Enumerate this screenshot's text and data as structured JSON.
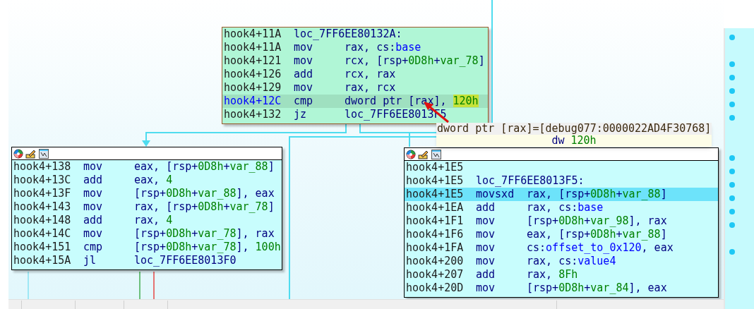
{
  "blocks": [
    {
      "kind": "active",
      "header": false,
      "lines": [
        {
          "addr": "hook4+11A",
          "label": "loc_7FF6EE80132A:",
          "selected": false
        },
        {
          "addr": "hook4+11A",
          "mnem": "mov",
          "ops": [
            {
              "kind": "plain",
              "text": "rax, cs:"
            },
            {
              "kind": "name",
              "text": "base"
            }
          ],
          "selected": false
        },
        {
          "addr": "hook4+121",
          "mnem": "mov",
          "ops": [
            {
              "kind": "plain",
              "text": "rcx, [rsp+"
            },
            {
              "kind": "number",
              "text": "0D8h"
            },
            {
              "kind": "plain",
              "text": "+"
            },
            {
              "kind": "number",
              "text": "var_78"
            },
            {
              "kind": "plain",
              "text": "]"
            }
          ],
          "selected": false
        },
        {
          "addr": "hook4+126",
          "mnem": "add",
          "ops": [
            {
              "kind": "plain",
              "text": "rcx, rax"
            }
          ],
          "selected": false
        },
        {
          "addr": "hook4+129",
          "mnem": "mov",
          "ops": [
            {
              "kind": "plain",
              "text": "rax, rcx"
            }
          ],
          "selected": false
        },
        {
          "addr": "hook4+12C",
          "mnem": "cmp",
          "ops": [
            {
              "kind": "plain",
              "text": "dword ptr [rax], "
            },
            {
              "kind": "number",
              "text": "120h",
              "highlighted": true
            }
          ],
          "selected": true
        },
        {
          "addr": "hook4+132",
          "mnem": "jz",
          "ops": [
            {
              "kind": "plain",
              "text": "loc_7FF6EE8013F5"
            }
          ],
          "selected": false
        }
      ]
    },
    {
      "kind": "normal",
      "header": true,
      "lines": [
        {
          "addr": "hook4+138",
          "mnem": "mov",
          "ops": [
            {
              "kind": "plain",
              "text": "eax, [rsp+"
            },
            {
              "kind": "number",
              "text": "0D8h"
            },
            {
              "kind": "plain",
              "text": "+"
            },
            {
              "kind": "number",
              "text": "var_88"
            },
            {
              "kind": "plain",
              "text": "]"
            }
          ],
          "selected": false
        },
        {
          "addr": "hook4+13C",
          "mnem": "add",
          "ops": [
            {
              "kind": "plain",
              "text": "eax, "
            },
            {
              "kind": "number",
              "text": "4"
            }
          ],
          "selected": false
        },
        {
          "addr": "hook4+13F",
          "mnem": "mov",
          "ops": [
            {
              "kind": "plain",
              "text": "[rsp+"
            },
            {
              "kind": "number",
              "text": "0D8h"
            },
            {
              "kind": "plain",
              "text": "+"
            },
            {
              "kind": "number",
              "text": "var_88"
            },
            {
              "kind": "plain",
              "text": "], eax"
            }
          ],
          "selected": false
        },
        {
          "addr": "hook4+143",
          "mnem": "mov",
          "ops": [
            {
              "kind": "plain",
              "text": "rax, [rsp+"
            },
            {
              "kind": "number",
              "text": "0D8h"
            },
            {
              "kind": "plain",
              "text": "+"
            },
            {
              "kind": "number",
              "text": "var_78"
            },
            {
              "kind": "plain",
              "text": "]"
            }
          ],
          "selected": false
        },
        {
          "addr": "hook4+148",
          "mnem": "add",
          "ops": [
            {
              "kind": "plain",
              "text": "rax, "
            },
            {
              "kind": "number",
              "text": "4"
            }
          ],
          "selected": false
        },
        {
          "addr": "hook4+14C",
          "mnem": "mov",
          "ops": [
            {
              "kind": "plain",
              "text": "[rsp+"
            },
            {
              "kind": "number",
              "text": "0D8h"
            },
            {
              "kind": "plain",
              "text": "+"
            },
            {
              "kind": "number",
              "text": "var_78"
            },
            {
              "kind": "plain",
              "text": "], rax"
            }
          ],
          "selected": false
        },
        {
          "addr": "hook4+151",
          "mnem": "cmp",
          "ops": [
            {
              "kind": "plain",
              "text": "[rsp+"
            },
            {
              "kind": "number",
              "text": "0D8h"
            },
            {
              "kind": "plain",
              "text": "+"
            },
            {
              "kind": "number",
              "text": "var_78"
            },
            {
              "kind": "plain",
              "text": "], "
            },
            {
              "kind": "number",
              "text": "100h"
            }
          ],
          "selected": false
        },
        {
          "addr": "hook4+15A",
          "mnem": "jl",
          "ops": [
            {
              "kind": "plain",
              "text": "loc_7FF6EE8013F0"
            }
          ],
          "selected": false
        }
      ]
    },
    {
      "kind": "normal",
      "header": true,
      "lines": [
        {
          "addr": "hook4+1E5",
          "selected": false
        },
        {
          "addr": "hook4+1E5",
          "label": "loc_7FF6EE8013F5:",
          "selected": false
        },
        {
          "addr": "hook4+1E5",
          "mnem": "movsxd",
          "ops": [
            {
              "kind": "plain",
              "text": "rax, [rsp+"
            },
            {
              "kind": "number",
              "text": "0D8h"
            },
            {
              "kind": "plain",
              "text": "+"
            },
            {
              "kind": "number",
              "text": "var_88"
            },
            {
              "kind": "plain",
              "text": "]"
            }
          ],
          "selected": true
        },
        {
          "addr": "hook4+1EA",
          "mnem": "add",
          "ops": [
            {
              "kind": "plain",
              "text": "rax, cs:"
            },
            {
              "kind": "name",
              "text": "base"
            }
          ],
          "selected": false
        },
        {
          "addr": "hook4+1F1",
          "mnem": "mov",
          "ops": [
            {
              "kind": "plain",
              "text": "[rsp+"
            },
            {
              "kind": "number",
              "text": "0D8h"
            },
            {
              "kind": "plain",
              "text": "+"
            },
            {
              "kind": "number",
              "text": "var_98"
            },
            {
              "kind": "plain",
              "text": "], rax"
            }
          ],
          "selected": false
        },
        {
          "addr": "hook4+1F6",
          "mnem": "mov",
          "ops": [
            {
              "kind": "plain",
              "text": "eax, [rsp+"
            },
            {
              "kind": "number",
              "text": "0D8h"
            },
            {
              "kind": "plain",
              "text": "+"
            },
            {
              "kind": "number",
              "text": "var_88"
            },
            {
              "kind": "plain",
              "text": "]"
            }
          ],
          "selected": false
        },
        {
          "addr": "hook4+1FA",
          "mnem": "mov",
          "ops": [
            {
              "kind": "plain",
              "text": "cs:"
            },
            {
              "kind": "name",
              "text": "offset_to_0x120"
            },
            {
              "kind": "plain",
              "text": ", eax"
            }
          ],
          "selected": false
        },
        {
          "addr": "hook4+200",
          "mnem": "mov",
          "ops": [
            {
              "kind": "plain",
              "text": "rax, cs:"
            },
            {
              "kind": "name",
              "text": "value4"
            }
          ],
          "selected": false
        },
        {
          "addr": "hook4+207",
          "mnem": "add",
          "ops": [
            {
              "kind": "plain",
              "text": "rax, "
            },
            {
              "kind": "number",
              "text": "8Fh"
            }
          ],
          "selected": false
        },
        {
          "addr": "hook4+20D",
          "mnem": "mov",
          "ops": [
            {
              "kind": "plain",
              "text": "[rsp+"
            },
            {
              "kind": "number",
              "text": "0D8h"
            },
            {
              "kind": "plain",
              "text": "+"
            },
            {
              "kind": "number",
              "text": "var_84"
            },
            {
              "kind": "plain",
              "text": "], eax"
            }
          ],
          "selected": false
        }
      ]
    }
  ],
  "tooltip": {
    "title": "dword ptr [rax]=[debug077:0000022AD4F30768]",
    "value": [
      {
        "kind": "plain",
        "text": "dw "
      },
      {
        "kind": "number",
        "text": "120h"
      }
    ]
  },
  "gutter": [
    {
      "dot": true
    },
    {
      "dot": false
    },
    {
      "dot": true
    },
    {
      "dot": true
    },
    {
      "dot": true
    },
    {
      "dot": true
    },
    {
      "dot": true
    },
    {
      "dot": false
    },
    {
      "dot": false
    },
    {
      "dot": true
    },
    {
      "dot": true
    },
    {
      "dot": true
    },
    {
      "dot": true
    },
    {
      "dot": true
    },
    {
      "dot": true
    },
    {
      "dot": false
    },
    {
      "dot": true
    },
    {
      "dot": false
    },
    {
      "dot": false
    }
  ]
}
